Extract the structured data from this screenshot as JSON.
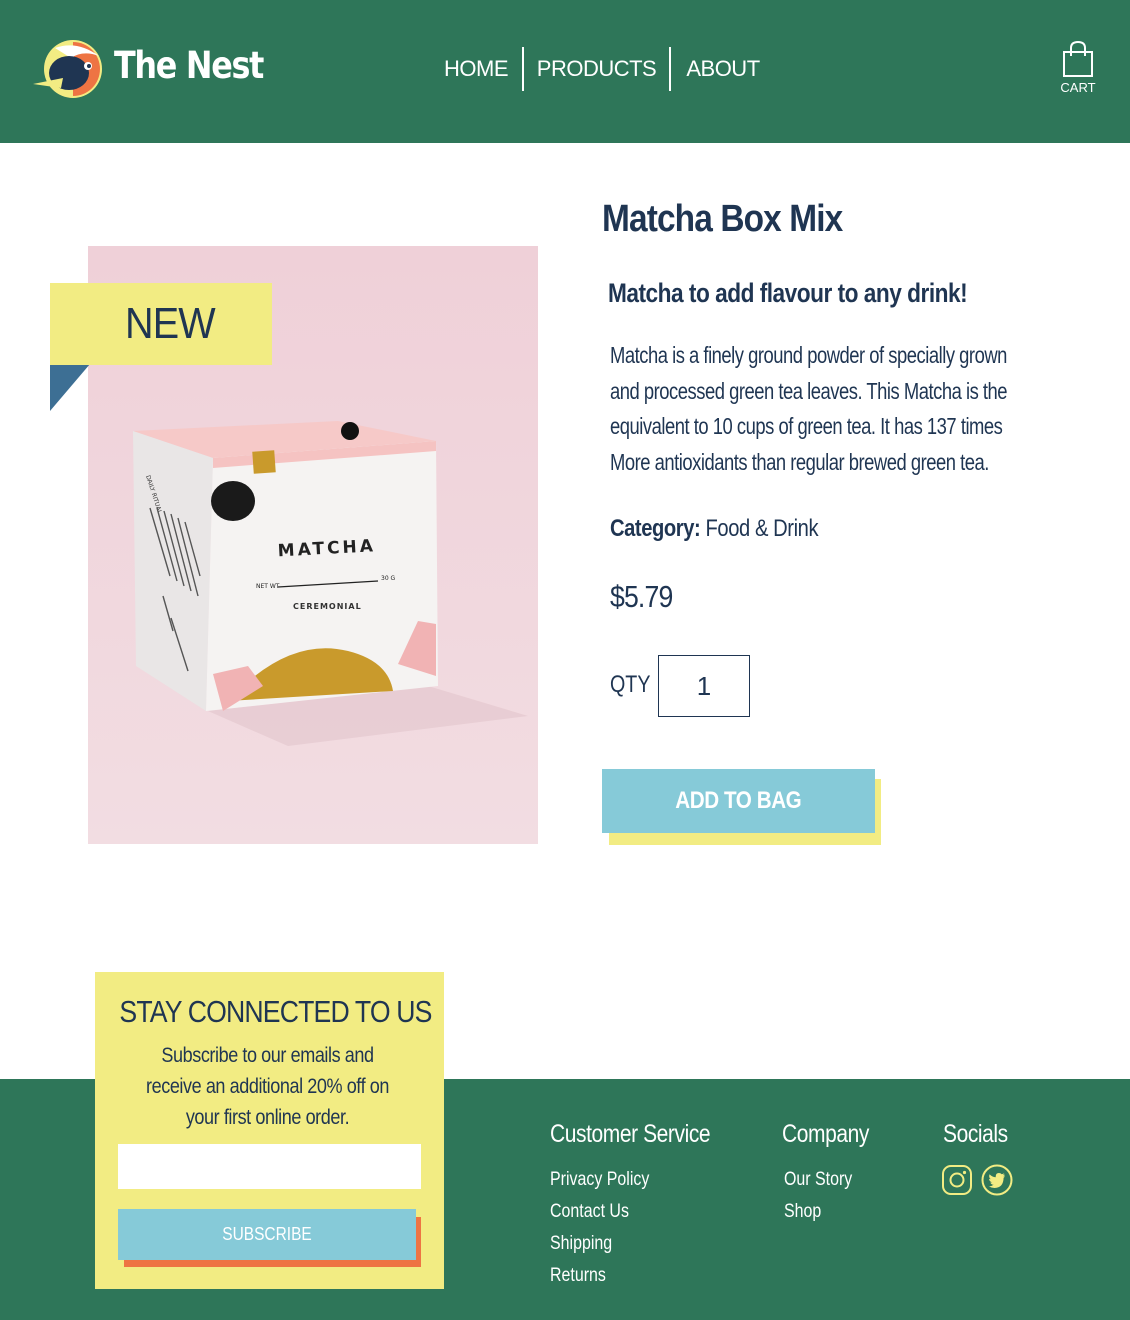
{
  "header": {
    "brand": "The Nest",
    "nav": [
      {
        "label": "HOME"
      },
      {
        "label": "PRODUCTS"
      },
      {
        "label": "ABOUT"
      }
    ],
    "cart_label": "CART"
  },
  "product": {
    "badge": "NEW",
    "title": "Matcha Box Mix",
    "subtitle": "Matcha to add flavour to any drink!",
    "description": "Matcha is a finely ground powder of specially grown and processed green tea leaves. This Matcha is the equivalent to 10 cups of green tea. It has 137 times More antioxidants than regular brewed green tea.",
    "category_label": "Category:",
    "category_value": "Food & Drink",
    "price": "$5.79",
    "qty_label": "QTY",
    "qty_value": "1",
    "add_button": "ADD TO BAG",
    "image": {
      "box_brand": "MATCHA",
      "box_subtitle": "CEREMONIAL",
      "box_net_wt": "NET WT",
      "box_weight": "30 G",
      "box_side_heading": "DAILY RITUAL"
    }
  },
  "subscribe": {
    "title": "STAY CONNECTED TO US",
    "text": "Subscribe to our emails and receive an additional 20% off on your first online order.",
    "email_value": "",
    "button": "SUBSCRIBE"
  },
  "footer": {
    "customer_service": {
      "title": "Customer Service",
      "links": [
        "Privacy Policy",
        "Contact Us",
        "Shipping",
        "Returns"
      ]
    },
    "company": {
      "title": "Company",
      "links": [
        "Our Story",
        "Shop"
      ]
    },
    "socials": {
      "title": "Socials",
      "icons": [
        "instagram-icon",
        "twitter-icon"
      ]
    }
  },
  "colors": {
    "header_green": "#2e7659",
    "navy": "#1f3552",
    "yellow": "#f2ec83",
    "light_blue": "#86cad8",
    "orange": "#ee7443",
    "pink_bg": "#f0d5dc"
  }
}
